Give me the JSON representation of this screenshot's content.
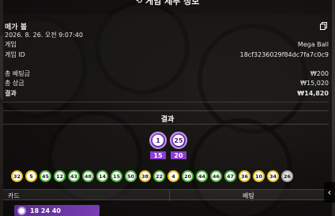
{
  "header": {
    "title": "게임 세부 정보",
    "icon": "history-icon"
  },
  "details": {
    "game_name": "메가 볼",
    "datetime": "2026. 8. 26. 오전 9:07:40",
    "game_label": "게임",
    "game_value": "Mega Ball",
    "game_id_label": "게임 ID",
    "game_id_value": "18cf3236029f84dc7fa7c0c9",
    "total_bet_label": "총 베팅금",
    "total_bet_value": "₩200",
    "total_win_label": "총 상금",
    "total_win_value": "₩15,020",
    "result_label": "결과",
    "result_value": "₩14,820"
  },
  "results": {
    "title": "결과",
    "bonus_balls": [
      {
        "number": "1",
        "multiplier": "15"
      },
      {
        "number": "25",
        "multiplier": "20"
      }
    ],
    "balls": [
      {
        "number": "32",
        "color": "yellow"
      },
      {
        "number": "5",
        "color": "yellow"
      },
      {
        "number": "45",
        "color": "green"
      },
      {
        "number": "12",
        "color": "green"
      },
      {
        "number": "43",
        "color": "green"
      },
      {
        "number": "48",
        "color": "green"
      },
      {
        "number": "14",
        "color": "green"
      },
      {
        "number": "15",
        "color": "green"
      },
      {
        "number": "50",
        "color": "green"
      },
      {
        "number": "38",
        "color": "yellow"
      },
      {
        "number": "22",
        "color": "green"
      },
      {
        "number": "4",
        "color": "yellow"
      },
      {
        "number": "20",
        "color": "green"
      },
      {
        "number": "44",
        "color": "green"
      },
      {
        "number": "46",
        "color": "green"
      },
      {
        "number": "47",
        "color": "green"
      },
      {
        "number": "36",
        "color": "yellow"
      },
      {
        "number": "10",
        "color": "yellow"
      },
      {
        "number": "34",
        "color": "yellow"
      },
      {
        "number": "26",
        "color": "gray"
      }
    ]
  },
  "table": {
    "col_card": "카드",
    "col_bet": "베팅",
    "first_row_numbers": "18  24  40"
  },
  "colors": {
    "accent_purple": "#8a3fd0",
    "ball_green": "#4cb83c",
    "ball_yellow": "#e8c21a"
  }
}
